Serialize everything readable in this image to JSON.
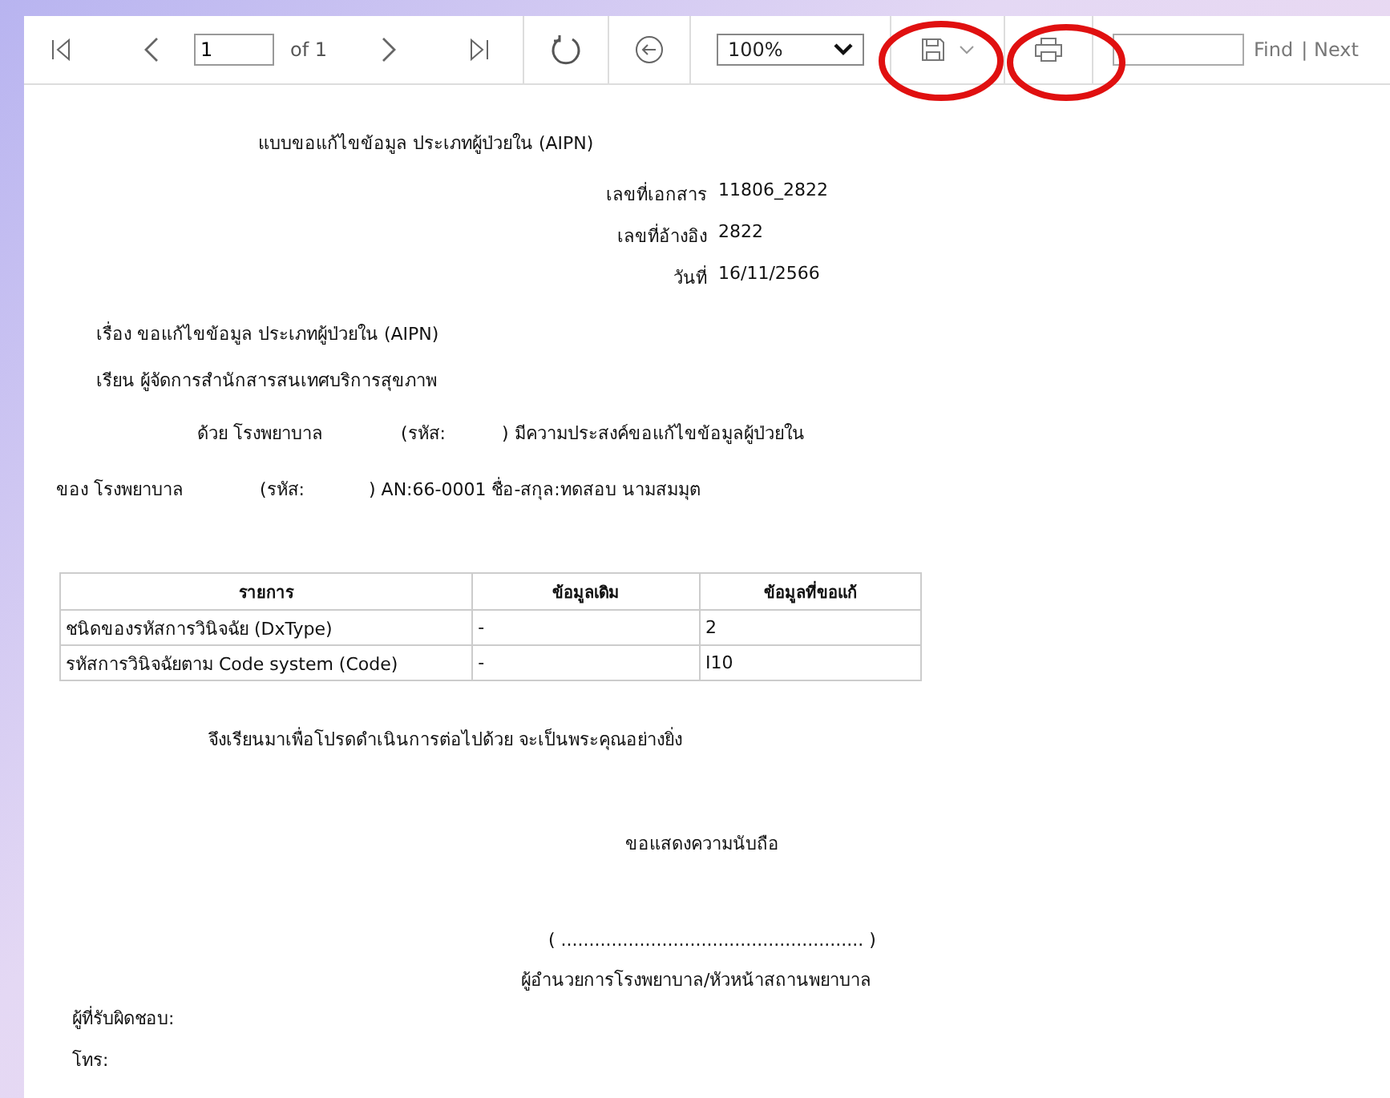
{
  "toolbar": {
    "page_input": "1",
    "page_count": "of 1",
    "zoom": "100%",
    "find": "Find",
    "next": "| Next"
  },
  "document": {
    "title": "แบบขอแก้ไขข้อมูล ประเภทผู้ป่วยใน (AIPN)",
    "fields": [
      {
        "label": "เลขที่เอกสาร",
        "value": "11806_2822"
      },
      {
        "label": "เลขที่อ้างอิง",
        "value": "2822"
      },
      {
        "label": "วันที่",
        "value": "16/11/2566"
      }
    ],
    "subject": "เรื่อง ขอแก้ไขข้อมูล ประเภทผู้ป่วยใน (AIPN)",
    "to": "เรียน ผู้จัดการสำนักสารสนเทศบริการสุขภาพ",
    "body_line_1": [
      "ด้วย โรงพยาบาล",
      "(รหัส:",
      ") มีความประสงค์ขอแก้ไขข้อมูลผู้ป่วยใน"
    ],
    "body_line_2": [
      "ของ โรงพยาบาล",
      "(รหัส:",
      ") AN:66-0001 ชื่อ-สกุล:ทดสอบ นามสมมุต"
    ],
    "table": {
      "columns": [
        "รายการ",
        "ข้อมูลเดิม",
        "ข้อมูลที่ขอแก้"
      ],
      "rows": [
        [
          "ชนิดของรหัสการวินิจฉัย (DxType)",
          "-",
          "2"
        ],
        [
          "รหัสการวินิจฉัยตาม Code system (Code)",
          "-",
          "I10"
        ]
      ]
    },
    "closing": "จึงเรียนมาเพื่อโปรดดำเนินการต่อไปด้วย จะเป็นพระคุณอย่างยิ่ง",
    "regards": "ขอแสดงความนับถือ",
    "signature": "( ...................................................... )",
    "signer": "ผู้อำนวยการโรงพยาบาล/หัวหน้าสถานพยาบาล",
    "responsible": "ผู้ที่รับผิดชอบ:",
    "phone": "โทร:"
  }
}
